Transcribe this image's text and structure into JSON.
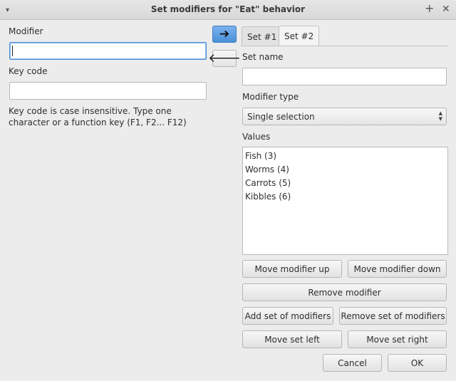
{
  "window": {
    "title": "Set modifiers for \"Eat\" behavior",
    "menu_glyph": "▾",
    "plus_glyph": "+",
    "close_glyph": "✕"
  },
  "left": {
    "modifier_label": "Modifier",
    "modifier_value": "",
    "key_code_label": "Key code",
    "key_code_value": "",
    "hint": "Key code is case insensitive. Type one character or a function key (F1, F2... F12)"
  },
  "arrows": {
    "right_glyph": "➔",
    "left_glyph": "🡐"
  },
  "tabs": [
    {
      "label": "Set #1",
      "active": false
    },
    {
      "label": "Set #2",
      "active": true
    }
  ],
  "right": {
    "set_name_label": "Set name",
    "set_name_value": "",
    "modifier_type_label": "Modifier type",
    "modifier_type_value": "Single selection",
    "values_label": "Values",
    "values": [
      "Fish (3)",
      "Worms (4)",
      "Carrots (5)",
      "Kibbles (6)"
    ]
  },
  "buttons": {
    "move_up": "Move modifier up",
    "move_down": "Move modifier down",
    "remove": "Remove modifier",
    "add_set": "Add set of modifiers",
    "remove_set": "Remove set of modifiers",
    "move_left": "Move set left",
    "move_right": "Move set right",
    "cancel": "Cancel",
    "ok": "OK"
  },
  "colors": {
    "accent": "#4a90d9",
    "background": "#ececec"
  }
}
